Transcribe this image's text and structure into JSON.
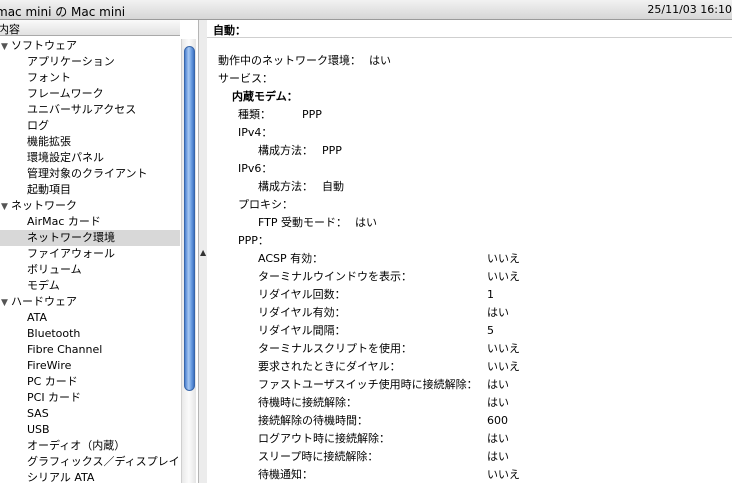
{
  "window": {
    "title": "mac mini の Mac mini",
    "date": "25/11/03 16:10"
  },
  "sidebar": {
    "column_header": "内容",
    "tree": [
      {
        "kind": "cat",
        "label": "ソフトウェア"
      },
      {
        "kind": "item",
        "label": "アプリケーション"
      },
      {
        "kind": "item",
        "label": "フォント"
      },
      {
        "kind": "item",
        "label": "フレームワーク"
      },
      {
        "kind": "item",
        "label": "ユニバーサルアクセス"
      },
      {
        "kind": "item",
        "label": "ログ"
      },
      {
        "kind": "item",
        "label": "機能拡張"
      },
      {
        "kind": "item",
        "label": "環境設定パネル"
      },
      {
        "kind": "item",
        "label": "管理対象のクライアント"
      },
      {
        "kind": "item",
        "label": "起動項目"
      },
      {
        "kind": "cat",
        "label": "ネットワーク"
      },
      {
        "kind": "item",
        "label": "AirMac カード"
      },
      {
        "kind": "item",
        "label": "ネットワーク環境",
        "selected": true
      },
      {
        "kind": "item",
        "label": "ファイアウォール"
      },
      {
        "kind": "item",
        "label": "ボリューム"
      },
      {
        "kind": "item",
        "label": "モデム"
      },
      {
        "kind": "cat",
        "label": "ハードウェア"
      },
      {
        "kind": "item",
        "label": "ATA"
      },
      {
        "kind": "item",
        "label": "Bluetooth"
      },
      {
        "kind": "item",
        "label": "Fibre Channel"
      },
      {
        "kind": "item",
        "label": "FireWire"
      },
      {
        "kind": "item",
        "label": "PC カード"
      },
      {
        "kind": "item",
        "label": "PCI カード"
      },
      {
        "kind": "item",
        "label": "SAS"
      },
      {
        "kind": "item",
        "label": "USB"
      },
      {
        "kind": "item",
        "label": "オーディオ（内蔵）"
      },
      {
        "kind": "item",
        "label": "グラフィックス／ディスプレイ"
      },
      {
        "kind": "item",
        "label": "シリアル ATA"
      }
    ]
  },
  "detail": {
    "header": "自動：",
    "active_label": "動作中のネットワーク環境：",
    "active_value": "はい",
    "services_label": "サービス：",
    "modem_label": "内蔵モデム：",
    "type_label": "種類：",
    "type_value": "PPP",
    "ipv4_label": "IPv4：",
    "ipv4_method_label": "構成方法：",
    "ipv4_method_value": "PPP",
    "ipv6_label": "IPv6：",
    "ipv6_method_label": "構成方法：",
    "ipv6_method_value": "自動",
    "proxy_label": "プロキシ：",
    "ftp_label": "FTP 受動モード：",
    "ftp_value": "はい",
    "ppp_label": "PPP：",
    "ppp_rows": [
      {
        "label": "ACSP 有効：",
        "value": "いいえ"
      },
      {
        "label": "ターミナルウインドウを表示：",
        "value": "いいえ"
      },
      {
        "label": "リダイヤル回数：",
        "value": "1"
      },
      {
        "label": "リダイヤル有効：",
        "value": "はい"
      },
      {
        "label": "リダイヤル間隔：",
        "value": "5"
      },
      {
        "label": "ターミナルスクリプトを使用：",
        "value": "いいえ"
      },
      {
        "label": "要求されたときにダイヤル：",
        "value": "いいえ"
      },
      {
        "label": "ファストユーザスイッチ使用時に接続解除：",
        "value": "はい"
      },
      {
        "label": "待機時に接続解除：",
        "value": "はい"
      },
      {
        "label": "接続解除の待機時間：",
        "value": "600"
      },
      {
        "label": "ログアウト時に接続解除：",
        "value": "はい"
      },
      {
        "label": "スリープ時に接続解除：",
        "value": "はい"
      },
      {
        "label": "待機通知：",
        "value": "いいえ"
      }
    ]
  }
}
